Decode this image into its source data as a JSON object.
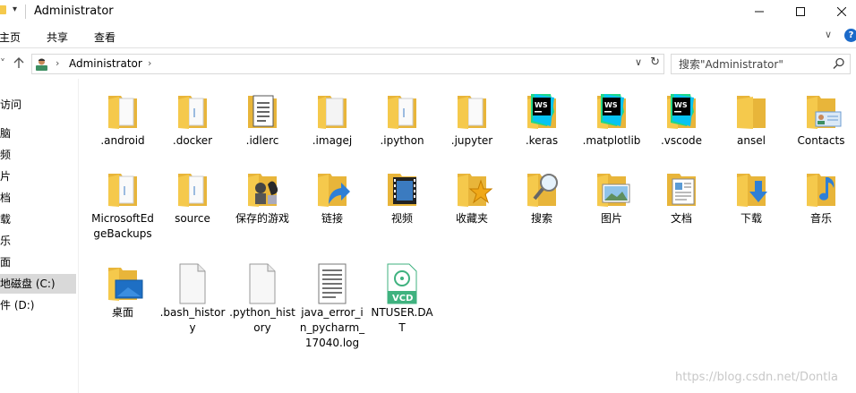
{
  "window": {
    "title": "Administrator"
  },
  "ribbon": {
    "tabs": [
      "主页",
      "共享",
      "查看"
    ],
    "help_label": "?"
  },
  "address": {
    "crumb": "Administrator"
  },
  "search": {
    "placeholder": "搜索\"Administrator\""
  },
  "navpane": {
    "items": [
      "访问",
      "脑",
      "频",
      "片",
      "档",
      "载",
      "乐",
      "面",
      "地磁盘 (C:)",
      "件 (D:)"
    ],
    "selected_index": 8
  },
  "files": [
    {
      "name": ".android",
      "icon": "folder-doc-icon"
    },
    {
      "name": ".docker",
      "icon": "folder-doc-icon"
    },
    {
      "name": ".idlerc",
      "icon": "text-doc-icon"
    },
    {
      "name": ".imagej",
      "icon": "folder-doc-icon"
    },
    {
      "name": ".ipython",
      "icon": "folder-doc-icon"
    },
    {
      "name": ".jupyter",
      "icon": "folder-doc-icon"
    },
    {
      "name": ".keras",
      "icon": "webstorm-folder-icon"
    },
    {
      "name": ".matplotlib",
      "icon": "webstorm-folder-icon"
    },
    {
      "name": ".vscode",
      "icon": "webstorm-folder-icon"
    },
    {
      "name": "ansel",
      "icon": "folder-icon"
    },
    {
      "name": "Contacts",
      "icon": "contacts-folder-icon"
    },
    {
      "name": "MicrosoftEdgeBackups",
      "icon": "folder-doc-icon"
    },
    {
      "name": "source",
      "icon": "folder-doc-icon"
    },
    {
      "name": "保存的游戏",
      "icon": "saved-games-icon"
    },
    {
      "name": "链接",
      "icon": "links-folder-icon"
    },
    {
      "name": "视频",
      "icon": "videos-folder-icon"
    },
    {
      "name": "收藏夹",
      "icon": "favorites-folder-icon"
    },
    {
      "name": "搜索",
      "icon": "search-folder-icon"
    },
    {
      "name": "图片",
      "icon": "pictures-folder-icon"
    },
    {
      "name": "文档",
      "icon": "documents-folder-icon"
    },
    {
      "name": "下载",
      "icon": "downloads-folder-icon"
    },
    {
      "name": "音乐",
      "icon": "music-folder-icon"
    },
    {
      "name": "桌面",
      "icon": "desktop-folder-icon"
    },
    {
      "name": ".bash_history",
      "icon": "blank-file-icon"
    },
    {
      "name": ".python_history",
      "icon": "blank-file-icon"
    },
    {
      "name": "java_error_in_pycharm_17040.log",
      "icon": "text-file-icon"
    },
    {
      "name": "NTUSER.DAT",
      "icon": "vcd-file-icon"
    }
  ],
  "watermark": "https://blog.csdn.net/Dontla",
  "colors": {
    "folder": "#f5c94c",
    "folder_back": "#e8b53a",
    "accent_blue": "#1b6ac9",
    "selection": "#d9d9d9"
  }
}
